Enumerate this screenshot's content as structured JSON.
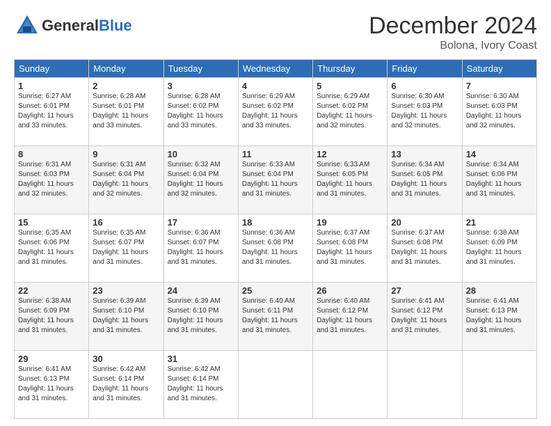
{
  "header": {
    "logo_line1": "General",
    "logo_line2": "Blue",
    "month": "December 2024",
    "location": "Bolona, Ivory Coast"
  },
  "days_of_week": [
    "Sunday",
    "Monday",
    "Tuesday",
    "Wednesday",
    "Thursday",
    "Friday",
    "Saturday"
  ],
  "weeks": [
    [
      {
        "day": "1",
        "sunrise": "6:27 AM",
        "sunset": "6:01 PM",
        "daylight": "11 hours and 33 minutes."
      },
      {
        "day": "2",
        "sunrise": "6:28 AM",
        "sunset": "6:01 PM",
        "daylight": "11 hours and 33 minutes."
      },
      {
        "day": "3",
        "sunrise": "6:28 AM",
        "sunset": "6:02 PM",
        "daylight": "11 hours and 33 minutes."
      },
      {
        "day": "4",
        "sunrise": "6:29 AM",
        "sunset": "6:02 PM",
        "daylight": "11 hours and 33 minutes."
      },
      {
        "day": "5",
        "sunrise": "6:29 AM",
        "sunset": "6:02 PM",
        "daylight": "11 hours and 32 minutes."
      },
      {
        "day": "6",
        "sunrise": "6:30 AM",
        "sunset": "6:03 PM",
        "daylight": "11 hours and 32 minutes."
      },
      {
        "day": "7",
        "sunrise": "6:30 AM",
        "sunset": "6:03 PM",
        "daylight": "11 hours and 32 minutes."
      }
    ],
    [
      {
        "day": "8",
        "sunrise": "6:31 AM",
        "sunset": "6:03 PM",
        "daylight": "11 hours and 32 minutes."
      },
      {
        "day": "9",
        "sunrise": "6:31 AM",
        "sunset": "6:04 PM",
        "daylight": "11 hours and 32 minutes."
      },
      {
        "day": "10",
        "sunrise": "6:32 AM",
        "sunset": "6:04 PM",
        "daylight": "11 hours and 32 minutes."
      },
      {
        "day": "11",
        "sunrise": "6:33 AM",
        "sunset": "6:04 PM",
        "daylight": "11 hours and 31 minutes."
      },
      {
        "day": "12",
        "sunrise": "6:33 AM",
        "sunset": "6:05 PM",
        "daylight": "11 hours and 31 minutes."
      },
      {
        "day": "13",
        "sunrise": "6:34 AM",
        "sunset": "6:05 PM",
        "daylight": "11 hours and 31 minutes."
      },
      {
        "day": "14",
        "sunrise": "6:34 AM",
        "sunset": "6:06 PM",
        "daylight": "11 hours and 31 minutes."
      }
    ],
    [
      {
        "day": "15",
        "sunrise": "6:35 AM",
        "sunset": "6:06 PM",
        "daylight": "11 hours and 31 minutes."
      },
      {
        "day": "16",
        "sunrise": "6:35 AM",
        "sunset": "6:07 PM",
        "daylight": "11 hours and 31 minutes."
      },
      {
        "day": "17",
        "sunrise": "6:36 AM",
        "sunset": "6:07 PM",
        "daylight": "11 hours and 31 minutes."
      },
      {
        "day": "18",
        "sunrise": "6:36 AM",
        "sunset": "6:08 PM",
        "daylight": "11 hours and 31 minutes."
      },
      {
        "day": "19",
        "sunrise": "6:37 AM",
        "sunset": "6:08 PM",
        "daylight": "11 hours and 31 minutes."
      },
      {
        "day": "20",
        "sunrise": "6:37 AM",
        "sunset": "6:08 PM",
        "daylight": "11 hours and 31 minutes."
      },
      {
        "day": "21",
        "sunrise": "6:38 AM",
        "sunset": "6:09 PM",
        "daylight": "11 hours and 31 minutes."
      }
    ],
    [
      {
        "day": "22",
        "sunrise": "6:38 AM",
        "sunset": "6:09 PM",
        "daylight": "11 hours and 31 minutes."
      },
      {
        "day": "23",
        "sunrise": "6:39 AM",
        "sunset": "6:10 PM",
        "daylight": "11 hours and 31 minutes."
      },
      {
        "day": "24",
        "sunrise": "6:39 AM",
        "sunset": "6:10 PM",
        "daylight": "11 hours and 31 minutes."
      },
      {
        "day": "25",
        "sunrise": "6:40 AM",
        "sunset": "6:11 PM",
        "daylight": "11 hours and 31 minutes."
      },
      {
        "day": "26",
        "sunrise": "6:40 AM",
        "sunset": "6:12 PM",
        "daylight": "11 hours and 31 minutes."
      },
      {
        "day": "27",
        "sunrise": "6:41 AM",
        "sunset": "6:12 PM",
        "daylight": "11 hours and 31 minutes."
      },
      {
        "day": "28",
        "sunrise": "6:41 AM",
        "sunset": "6:13 PM",
        "daylight": "11 hours and 31 minutes."
      }
    ],
    [
      {
        "day": "29",
        "sunrise": "6:41 AM",
        "sunset": "6:13 PM",
        "daylight": "11 hours and 31 minutes."
      },
      {
        "day": "30",
        "sunrise": "6:42 AM",
        "sunset": "6:14 PM",
        "daylight": "11 hours and 31 minutes."
      },
      {
        "day": "31",
        "sunrise": "6:42 AM",
        "sunset": "6:14 PM",
        "daylight": "11 hours and 31 minutes."
      },
      null,
      null,
      null,
      null
    ]
  ]
}
